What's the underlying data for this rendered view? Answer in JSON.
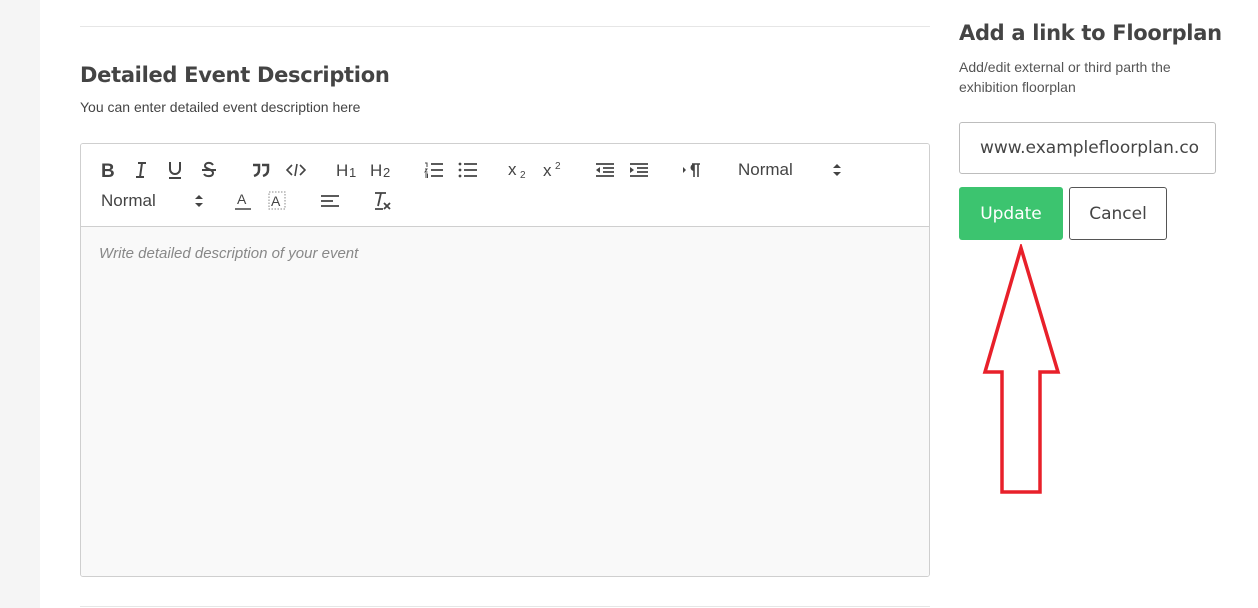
{
  "section": {
    "title": "Detailed Event Description",
    "subtitle": "You can enter detailed event description here"
  },
  "editor": {
    "placeholder": "Write detailed description of your event",
    "toolbar": {
      "header_picker_value": "Normal",
      "size_picker_value": "Normal",
      "buttons": [
        "bold",
        "italic",
        "underline",
        "strike",
        "blockquote",
        "code-block",
        "header-1",
        "header-2",
        "ordered-list",
        "bullet-list",
        "subscript",
        "superscript",
        "outdent",
        "indent",
        "text-direction",
        "text-color",
        "background-color",
        "align",
        "clean"
      ]
    }
  },
  "panel": {
    "title": "Add a link to Floorplan",
    "description": "Add/edit external or third parth the exhibition floorplan",
    "link_value": "www.examplefloorplan.co",
    "update_label": "Update",
    "cancel_label": "Cancel"
  },
  "colors": {
    "accent_green": "#3cc46f",
    "annotation_red": "#e8202a"
  },
  "icons": {
    "annotation": "red-up-arrow"
  }
}
